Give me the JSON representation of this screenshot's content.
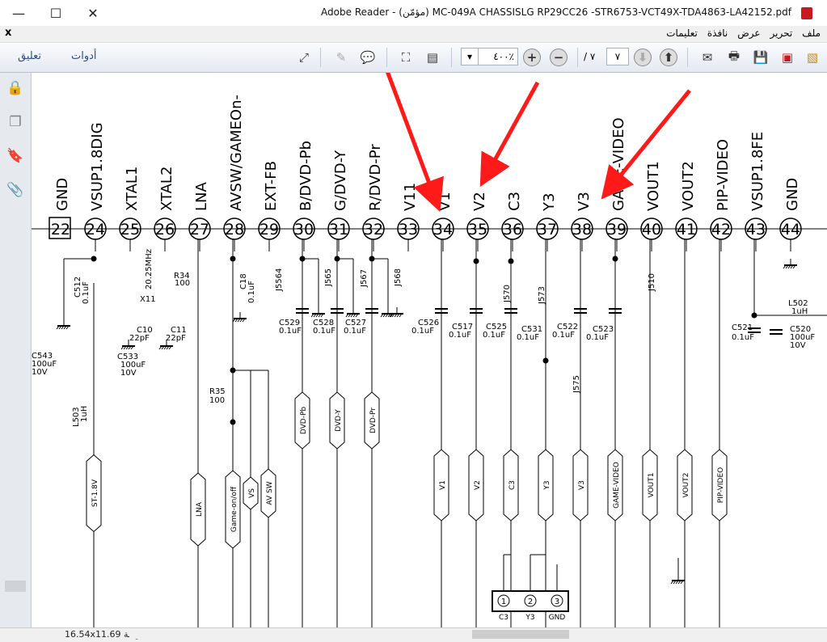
{
  "window": {
    "title": "Adobe Reader - (مؤمّن)  MC-049A CHASSISLG RP29CC26 -STR6753-VCT49X-TDA4863-LA42152.pdf",
    "minimize": "—",
    "maximize": "☐",
    "close": "✕"
  },
  "menu": {
    "close_doc": "x",
    "items": [
      "ملف",
      "تحرير",
      "عرض",
      "نافذة",
      "تعليمات"
    ]
  },
  "toolbar": {
    "comment_link": "تعليق",
    "tools_link": "أدوات",
    "zoom_value": "٤٠٠٪",
    "page_current": "٧",
    "page_total": "/ ٧"
  },
  "status": {
    "page_size": "16.54x11.69 بوصة"
  },
  "schematic": {
    "pins": [
      {
        "num": "22",
        "label": "GND"
      },
      {
        "num": "24",
        "label": "VSUP1.8DIG"
      },
      {
        "num": "25",
        "label": "XTAL1"
      },
      {
        "num": "26",
        "label": "XTAL2"
      },
      {
        "num": "27",
        "label": "LNA"
      },
      {
        "num": "28",
        "label": "AVSW/GAMEOn-"
      },
      {
        "num": "29",
        "label": "EXT-FB"
      },
      {
        "num": "30",
        "label": "B/DVD-Pb"
      },
      {
        "num": "31",
        "label": "G/DVD-Y"
      },
      {
        "num": "32",
        "label": "R/DVD-Pr"
      },
      {
        "num": "33",
        "label": "V11"
      },
      {
        "num": "34",
        "label": "V1"
      },
      {
        "num": "35",
        "label": "V2"
      },
      {
        "num": "36",
        "label": "C3"
      },
      {
        "num": "37",
        "label": "Y3"
      },
      {
        "num": "38",
        "label": "V3"
      },
      {
        "num": "39",
        "label": "GAME-VIDEO"
      },
      {
        "num": "40",
        "label": "VOUT1"
      },
      {
        "num": "41",
        "label": "VOUT2"
      },
      {
        "num": "42",
        "label": "PIP-VIDEO"
      },
      {
        "num": "43",
        "label": "VSUP1.8FE"
      },
      {
        "num": "44",
        "label": "GND"
      }
    ],
    "connectors": [
      "ST-1.8V",
      "LNA",
      "Game-on/off",
      "VS",
      "AV SW",
      "DVD-Pb",
      "DVD-Y",
      "DVD-Pr",
      "V1",
      "V2",
      "C3",
      "Y3",
      "V3",
      "GAME-VIDEO",
      "VOUT1",
      "VOUT2",
      "PIP-VIDEO"
    ],
    "components": {
      "c512": "C512",
      "c512v": "0.1uF",
      "c543": "C543",
      "c543v": "100uF",
      "c543volt": "10V",
      "l503": "L503",
      "l503v": "1uH",
      "c533": "C533",
      "c533v": "100uF",
      "c533volt": "10V",
      "x11": "X11",
      "x11v": "20.25MHz",
      "c10": "C10",
      "c10v": "22pF",
      "c11": "C11",
      "c11v": "22pF",
      "r34": "R34",
      "r34v": "100",
      "c18": "C18",
      "c18v": "0.1uF",
      "j5564": "J5564",
      "r35": "R35",
      "r35v": "100",
      "j565": "J565",
      "j567": "J567",
      "j568": "J568",
      "c529": "C529",
      "c529v": "0.1uF",
      "c528": "C528",
      "c528v": "0.1uF",
      "c527": "C527",
      "c527v": "0.1uF",
      "c526": "C526",
      "c526v": "0.1uF",
      "c517": "C517",
      "c517v": "0.1uF",
      "c525": "C525",
      "c525v": "0.1uF",
      "c531": "C531",
      "c531v": "0.1uF",
      "c522": "C522",
      "c522v": "0.1uF",
      "c523": "C523",
      "c523v": "0.1uF",
      "j570": "J570",
      "j573": "J573",
      "j575": "J575",
      "j510": "J510",
      "c521": "C521",
      "c521v": "0.1uF",
      "c520": "C520",
      "c520v": "100uF",
      "c520volt": "10V",
      "l502": "L502",
      "l502v": "1uH"
    },
    "header_pins": [
      "1",
      "2",
      "3"
    ],
    "header_labels": [
      "C3",
      "Y3",
      "GND"
    ]
  },
  "colors": {
    "arrow": "#ff1a1a",
    "toolbar_link": "#2d4f87",
    "pdf_red": "#c9181e"
  }
}
